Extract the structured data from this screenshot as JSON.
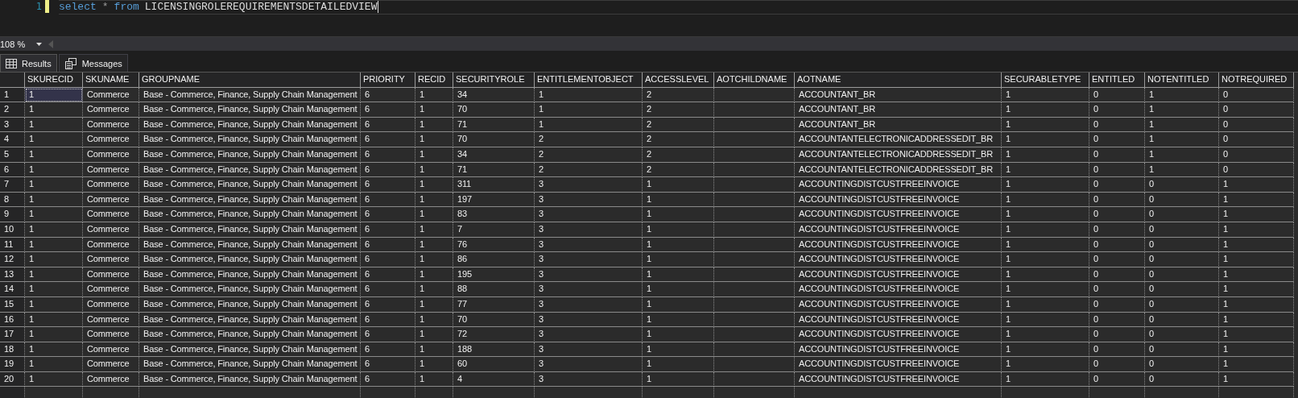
{
  "editor": {
    "line_number": "1",
    "tokens": [
      {
        "kind": "keyword",
        "text": "select"
      },
      {
        "kind": "operator",
        "text": "*"
      },
      {
        "kind": "keyword",
        "text": "from"
      },
      {
        "kind": "identifier",
        "text": "LICENSINGROLEREQUIREMENTSDETAILEDVIEW"
      }
    ]
  },
  "zoom": {
    "value": "108 %"
  },
  "tabs": [
    {
      "label": "Results",
      "selected": true
    },
    {
      "label": "Messages",
      "selected": false
    }
  ],
  "table": {
    "columns": [
      "SKURECID",
      "SKUNAME",
      "GROUPNAME",
      "PRIORITY",
      "RECID",
      "SECURITYROLE",
      "ENTITLEMENTOBJECT",
      "ACCESSLEVEL",
      "AOTCHILDNAME",
      "AOTNAME",
      "SECURABLETYPE",
      "ENTITLED",
      "NOTENTITLED",
      "NOTREQUIRED"
    ],
    "rows": [
      {
        "number": "1",
        "selected": true,
        "cells": [
          "1",
          "Commerce",
          "Base - Commerce, Finance, Supply Chain Management",
          "6",
          "1",
          "34",
          "1",
          "2",
          "",
          "ACCOUNTANT_BR",
          "1",
          "0",
          "1",
          "0"
        ]
      },
      {
        "number": "2",
        "selected": false,
        "cells": [
          "1",
          "Commerce",
          "Base - Commerce, Finance, Supply Chain Management",
          "6",
          "1",
          "70",
          "1",
          "2",
          "",
          "ACCOUNTANT_BR",
          "1",
          "0",
          "1",
          "0"
        ]
      },
      {
        "number": "3",
        "selected": false,
        "cells": [
          "1",
          "Commerce",
          "Base - Commerce, Finance, Supply Chain Management",
          "6",
          "1",
          "71",
          "1",
          "2",
          "",
          "ACCOUNTANT_BR",
          "1",
          "0",
          "1",
          "0"
        ]
      },
      {
        "number": "4",
        "selected": false,
        "cells": [
          "1",
          "Commerce",
          "Base - Commerce, Finance, Supply Chain Management",
          "6",
          "1",
          "70",
          "2",
          "2",
          "",
          "ACCOUNTANTELECTRONICADDRESSEDIT_BR",
          "1",
          "0",
          "1",
          "0"
        ]
      },
      {
        "number": "5",
        "selected": false,
        "cells": [
          "1",
          "Commerce",
          "Base - Commerce, Finance, Supply Chain Management",
          "6",
          "1",
          "34",
          "2",
          "2",
          "",
          "ACCOUNTANTELECTRONICADDRESSEDIT_BR",
          "1",
          "0",
          "1",
          "0"
        ]
      },
      {
        "number": "6",
        "selected": false,
        "cells": [
          "1",
          "Commerce",
          "Base - Commerce, Finance, Supply Chain Management",
          "6",
          "1",
          "71",
          "2",
          "2",
          "",
          "ACCOUNTANTELECTRONICADDRESSEDIT_BR",
          "1",
          "0",
          "1",
          "0"
        ]
      },
      {
        "number": "7",
        "selected": false,
        "cells": [
          "1",
          "Commerce",
          "Base - Commerce, Finance, Supply Chain Management",
          "6",
          "1",
          "311",
          "3",
          "1",
          "",
          "ACCOUNTINGDISTCUSTFREEINVOICE",
          "1",
          "0",
          "0",
          "1"
        ]
      },
      {
        "number": "8",
        "selected": false,
        "cells": [
          "1",
          "Commerce",
          "Base - Commerce, Finance, Supply Chain Management",
          "6",
          "1",
          "197",
          "3",
          "1",
          "",
          "ACCOUNTINGDISTCUSTFREEINVOICE",
          "1",
          "0",
          "0",
          "1"
        ]
      },
      {
        "number": "9",
        "selected": false,
        "cells": [
          "1",
          "Commerce",
          "Base - Commerce, Finance, Supply Chain Management",
          "6",
          "1",
          "83",
          "3",
          "1",
          "",
          "ACCOUNTINGDISTCUSTFREEINVOICE",
          "1",
          "0",
          "0",
          "1"
        ]
      },
      {
        "number": "10",
        "selected": false,
        "cells": [
          "1",
          "Commerce",
          "Base - Commerce, Finance, Supply Chain Management",
          "6",
          "1",
          "7",
          "3",
          "1",
          "",
          "ACCOUNTINGDISTCUSTFREEINVOICE",
          "1",
          "0",
          "0",
          "1"
        ]
      },
      {
        "number": "11",
        "selected": false,
        "cells": [
          "1",
          "Commerce",
          "Base - Commerce, Finance, Supply Chain Management",
          "6",
          "1",
          "76",
          "3",
          "1",
          "",
          "ACCOUNTINGDISTCUSTFREEINVOICE",
          "1",
          "0",
          "0",
          "1"
        ]
      },
      {
        "number": "12",
        "selected": false,
        "cells": [
          "1",
          "Commerce",
          "Base - Commerce, Finance, Supply Chain Management",
          "6",
          "1",
          "86",
          "3",
          "1",
          "",
          "ACCOUNTINGDISTCUSTFREEINVOICE",
          "1",
          "0",
          "0",
          "1"
        ]
      },
      {
        "number": "13",
        "selected": false,
        "cells": [
          "1",
          "Commerce",
          "Base - Commerce, Finance, Supply Chain Management",
          "6",
          "1",
          "195",
          "3",
          "1",
          "",
          "ACCOUNTINGDISTCUSTFREEINVOICE",
          "1",
          "0",
          "0",
          "1"
        ]
      },
      {
        "number": "14",
        "selected": false,
        "cells": [
          "1",
          "Commerce",
          "Base - Commerce, Finance, Supply Chain Management",
          "6",
          "1",
          "88",
          "3",
          "1",
          "",
          "ACCOUNTINGDISTCUSTFREEINVOICE",
          "1",
          "0",
          "0",
          "1"
        ]
      },
      {
        "number": "15",
        "selected": false,
        "cells": [
          "1",
          "Commerce",
          "Base - Commerce, Finance, Supply Chain Management",
          "6",
          "1",
          "77",
          "3",
          "1",
          "",
          "ACCOUNTINGDISTCUSTFREEINVOICE",
          "1",
          "0",
          "0",
          "1"
        ]
      },
      {
        "number": "16",
        "selected": false,
        "cells": [
          "1",
          "Commerce",
          "Base - Commerce, Finance, Supply Chain Management",
          "6",
          "1",
          "70",
          "3",
          "1",
          "",
          "ACCOUNTINGDISTCUSTFREEINVOICE",
          "1",
          "0",
          "0",
          "1"
        ]
      },
      {
        "number": "17",
        "selected": false,
        "cells": [
          "1",
          "Commerce",
          "Base - Commerce, Finance, Supply Chain Management",
          "6",
          "1",
          "72",
          "3",
          "1",
          "",
          "ACCOUNTINGDISTCUSTFREEINVOICE",
          "1",
          "0",
          "0",
          "1"
        ]
      },
      {
        "number": "18",
        "selected": false,
        "cells": [
          "1",
          "Commerce",
          "Base - Commerce, Finance, Supply Chain Management",
          "6",
          "1",
          "188",
          "3",
          "1",
          "",
          "ACCOUNTINGDISTCUSTFREEINVOICE",
          "1",
          "0",
          "0",
          "1"
        ]
      },
      {
        "number": "19",
        "selected": false,
        "cells": [
          "1",
          "Commerce",
          "Base - Commerce, Finance, Supply Chain Management",
          "6",
          "1",
          "60",
          "3",
          "1",
          "",
          "ACCOUNTINGDISTCUSTFREEINVOICE",
          "1",
          "0",
          "0",
          "1"
        ]
      },
      {
        "number": "20",
        "selected": false,
        "cells": [
          "1",
          "Commerce",
          "Base - Commerce, Finance, Supply Chain Management",
          "6",
          "1",
          "4",
          "3",
          "1",
          "",
          "ACCOUNTINGDISTCUSTFREEINVOICE",
          "1",
          "0",
          "0",
          "1"
        ]
      }
    ]
  }
}
